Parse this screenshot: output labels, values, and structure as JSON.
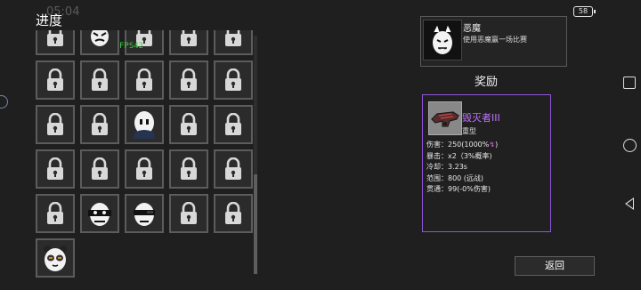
{
  "status_bar": {
    "time": "05:04",
    "battery": "58"
  },
  "header": {
    "title": "进度"
  },
  "overlay": {
    "fps": "FPS42"
  },
  "grid": {
    "cells": [
      [
        "lock-icon",
        "skull-face-icon",
        "lock-icon",
        "lock-icon",
        "lock-icon"
      ],
      [
        "lock-icon",
        "lock-icon",
        "lock-icon",
        "lock-icon",
        "lock-icon"
      ],
      [
        "lock-icon",
        "lock-icon",
        "egg-scarf-icon",
        "lock-icon",
        "lock-icon"
      ],
      [
        "lock-icon",
        "lock-icon",
        "lock-icon",
        "lock-icon",
        "lock-icon"
      ],
      [
        "lock-icon",
        "egg-mask-icon",
        "egg-shades-icon",
        "lock-icon",
        "lock-icon"
      ],
      [
        "egg-panda-icon"
      ]
    ]
  },
  "achievement": {
    "name": "恶魔",
    "description": "使用恶魔赢一场比赛",
    "icon": "demon-egg-icon"
  },
  "reward": {
    "title": "奖励",
    "weapon": {
      "name": "毁灭者III",
      "type": "重型",
      "icon": "heavy-gun-icon",
      "stats": {
        "damage": "伤害：250(1000%",
        "damage_tag": "↯",
        "damage_end": ")",
        "crit": "暴击：x2（3%概率)",
        "cooldown": "冷却：3.23s",
        "range": "范围：800 (远战)",
        "pierce": "贯通：99(-0%伤害)"
      }
    }
  },
  "actions": {
    "back": "返回"
  },
  "colors": {
    "accent": "#8f55d8",
    "weapon_name": "#c172ff",
    "fps": "#3fce3f"
  }
}
